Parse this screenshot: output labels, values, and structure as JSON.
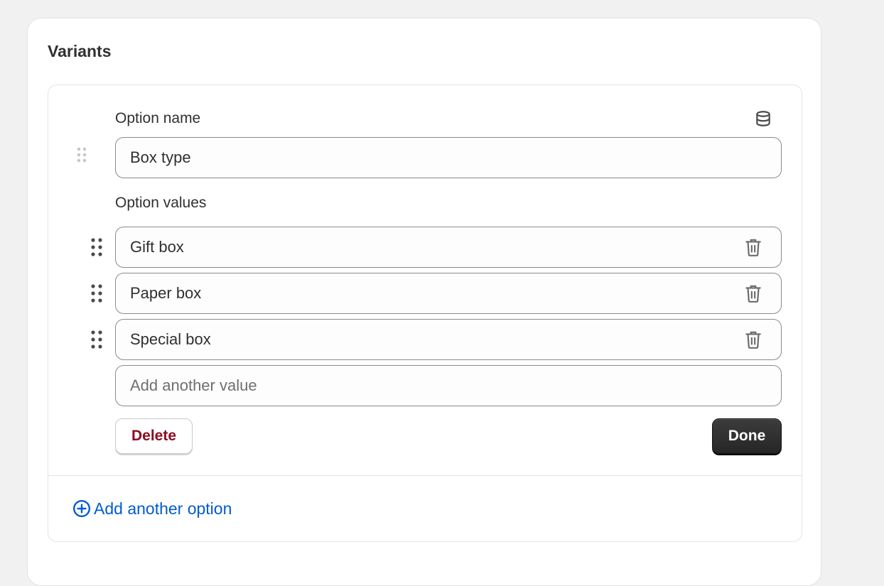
{
  "card": {
    "title": "Variants"
  },
  "option": {
    "name_label": "Option name",
    "name_value": "Box type",
    "values_label": "Option values",
    "values": [
      {
        "label": "Gift box"
      },
      {
        "label": "Paper box"
      },
      {
        "label": "Special box"
      }
    ],
    "add_value_placeholder": "Add another value",
    "delete_label": "Delete",
    "done_label": "Done"
  },
  "footer": {
    "add_option_label": "Add another option"
  },
  "icons": {
    "metafield": "database-icon",
    "drag": "drag-handle-icon",
    "remove": "trash-icon",
    "add": "plus-circle-icon"
  },
  "colors": {
    "link": "#005bd3",
    "critical_text": "#8e0b21",
    "primary_button": "#303030"
  }
}
